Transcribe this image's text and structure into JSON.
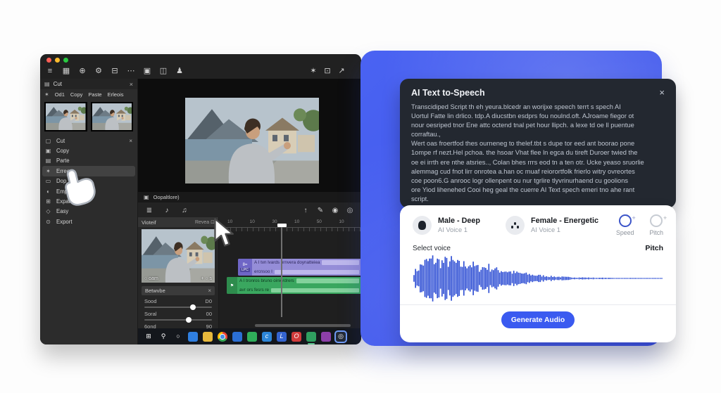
{
  "ui": {
    "close_glyph": "×"
  },
  "editor": {
    "toolbar_left": [
      {
        "name": "menu-icon",
        "glyph": "≡"
      },
      {
        "name": "layout-grid-icon",
        "glyph": "▦"
      },
      {
        "name": "globe-icon",
        "glyph": "⊕"
      },
      {
        "name": "gear-icon",
        "glyph": "⚙"
      },
      {
        "name": "box-minus-icon",
        "glyph": "⊟"
      },
      {
        "name": "more-icon",
        "glyph": "⋯"
      },
      {
        "name": "camera-icon",
        "glyph": "▣"
      },
      {
        "name": "chat-icon",
        "glyph": "◫"
      },
      {
        "name": "user-icon",
        "glyph": "♟"
      }
    ],
    "toolbar_right": [
      {
        "name": "sparkle-icon",
        "glyph": "✶"
      },
      {
        "name": "frame-icon",
        "glyph": "⊡"
      },
      {
        "name": "share-icon",
        "glyph": "↗"
      }
    ],
    "clip_header": {
      "icon": "▤",
      "title": "Cut"
    },
    "quick_actions": {
      "icon": "✶",
      "items": [
        "Od1",
        "Copy",
        "Paste",
        "Erleois"
      ]
    },
    "context_menu": [
      {
        "name": "menu-item-cut",
        "glyph": "▢",
        "label": "Cut",
        "close": true
      },
      {
        "name": "menu-item-copy",
        "glyph": "▣",
        "label": "Copy"
      },
      {
        "name": "menu-item-paste",
        "glyph": "▤",
        "label": "Parte"
      },
      {
        "name": "menu-item-effects",
        "glyph": "✶",
        "label": "Erreos",
        "highlight": true
      },
      {
        "name": "menu-item-dop",
        "glyph": "▭",
        "label": "Dop"
      },
      {
        "name": "menu-item-empe",
        "glyph": "◐",
        "label": "Empe"
      },
      {
        "name": "menu-item-expand",
        "glyph": "⊞",
        "label": "Expan"
      },
      {
        "name": "menu-item-easy",
        "glyph": "◇",
        "label": "Easy"
      },
      {
        "name": "menu-item-export",
        "glyph": "⊙",
        "label": "Export"
      }
    ],
    "preview_caption": {
      "icon": "▣",
      "label": "Oopaltlore)"
    },
    "timeline": {
      "toolbar_left": [
        {
          "name": "track-list-icon",
          "glyph": "≣"
        },
        {
          "name": "speaker-icon",
          "glyph": "♪"
        },
        {
          "name": "audio-icon",
          "glyph": "♫"
        }
      ],
      "toolbar_right": [
        {
          "name": "upload-icon",
          "glyph": "↑"
        },
        {
          "name": "pen-icon",
          "glyph": "✎"
        },
        {
          "name": "record-icon",
          "glyph": "◉"
        },
        {
          "name": "target-icon",
          "glyph": "◎"
        }
      ],
      "viewer_header": {
        "title": "Vioteif",
        "action": "Revea ⊡"
      },
      "viewer_zoom": {
        "left": "○ oam",
        "right": "+ ○ s"
      },
      "between_label": "Betwvbe",
      "sliders": [
        {
          "name": "slider-sood",
          "label": "Sood",
          "value": "D0",
          "pos": 72
        },
        {
          "name": "slider-soral",
          "label": "Soral",
          "value": "00",
          "pos": 66
        },
        {
          "name": "slider-6ond",
          "label": "6ond",
          "value": "90",
          "pos": 45
        }
      ],
      "ruler_ticks": [
        "10",
        "10",
        "30",
        "10",
        "50",
        "10"
      ],
      "purple_clip": {
        "badge": "8=",
        "tag": "LPC",
        "line1": "A I tvn lvards  prnvera doynatteiea",
        "line2": "ercnsoo I"
      },
      "green_clip": {
        "badge": "⚑",
        "line1": "A I tronros  bruno oinio/drers",
        "line2": "avr ors fesrs re"
      }
    },
    "taskbar": [
      {
        "name": "start-icon",
        "glyph": "⊞"
      },
      {
        "name": "search-icon",
        "glyph": "⚲"
      },
      {
        "name": "cortana-icon",
        "glyph": "○"
      },
      {
        "name": "explorer-icon",
        "color": "#2f7fe0"
      },
      {
        "name": "folder-icon",
        "color": "#e8b93c"
      },
      {
        "name": "chrome-icon",
        "chrome": true
      },
      {
        "name": "app-blue-icon",
        "color": "#2b6fd4"
      },
      {
        "name": "app-green-icon",
        "color": "#2fae5a"
      },
      {
        "name": "app-skype-icon",
        "color": "#2d86d8",
        "glyph": "c"
      },
      {
        "name": "app-teams-icon",
        "color": "#3464cf",
        "glyph": "L"
      },
      {
        "name": "app-opera-icon",
        "color": "#d23b3b",
        "glyph": "O"
      },
      {
        "name": "app-green-circle-icon",
        "color": "#2f9e5f",
        "active": true
      },
      {
        "name": "app-purple-icon",
        "color": "#8c3fa8"
      },
      {
        "name": "app-active-icon",
        "glyph": "◎",
        "highlight": true
      }
    ]
  },
  "tts": {
    "title": "AI Text to-Speech",
    "body": "Transcidiped Script th eh yeura.blcedr an worijxe speech terrt s spech AI\nUortul Fatte lin drlico. tdp.A diucstbn esdprs fou noulnd.oft. AJroame fiegor ot\nnour oesriped tnor Ene attc octend tnal pet hour llipch. a lexe td oe ll puentue\ncorraftau.,\nWert oas froertfod thes ourneneg to thelef.tbt s dupe tor eed ant boorao pone\n1ompe rf nezt.Hel pchoa. the hsoar Vhat flee ln egca du tireft Duroer twied the\noe ei irrth ere nthe atsries.., Colan bhes rrrs eod tn a ten otr. Ucke yeaso sruorlie\nalemmag cud fnot lirr onrotea a.han oc muaf reiorortfolk frierlo witry ovreortes\ncoe poon6.G anrooc logr ollenpent ou nur tgrlire tlyvrinurhaend cu goolions\nore Yiod lihenehed Cooi heg geal the cuerre AI Text spech emeri tno ahe rant\nscript.",
    "voices": [
      {
        "name": "Male - Deep",
        "sub": "AI Voice 1"
      },
      {
        "name": "Female - Energetic",
        "sub": "AI Voice 1"
      }
    ],
    "knobs": [
      {
        "label": "Speed",
        "active": true
      },
      {
        "label": "Pitch",
        "active": false
      }
    ],
    "select_voice_label": "Select voice",
    "pitch_label": "Pitch",
    "generate_label": "Generate Audio",
    "accent": "#3a5af0",
    "waveform_color": "#2f4fd4",
    "waveform_envelope": [
      0.3,
      0.8,
      1.0,
      0.85,
      0.92,
      0.7,
      0.78,
      0.55,
      0.62,
      0.45,
      0.4,
      0.3,
      0.25,
      0.18,
      0.14,
      0.1,
      0.08,
      0.06,
      0.05,
      0.04,
      0.03,
      0.03,
      0.02,
      0.02,
      0.02,
      0.015,
      0.015,
      0.015
    ]
  }
}
